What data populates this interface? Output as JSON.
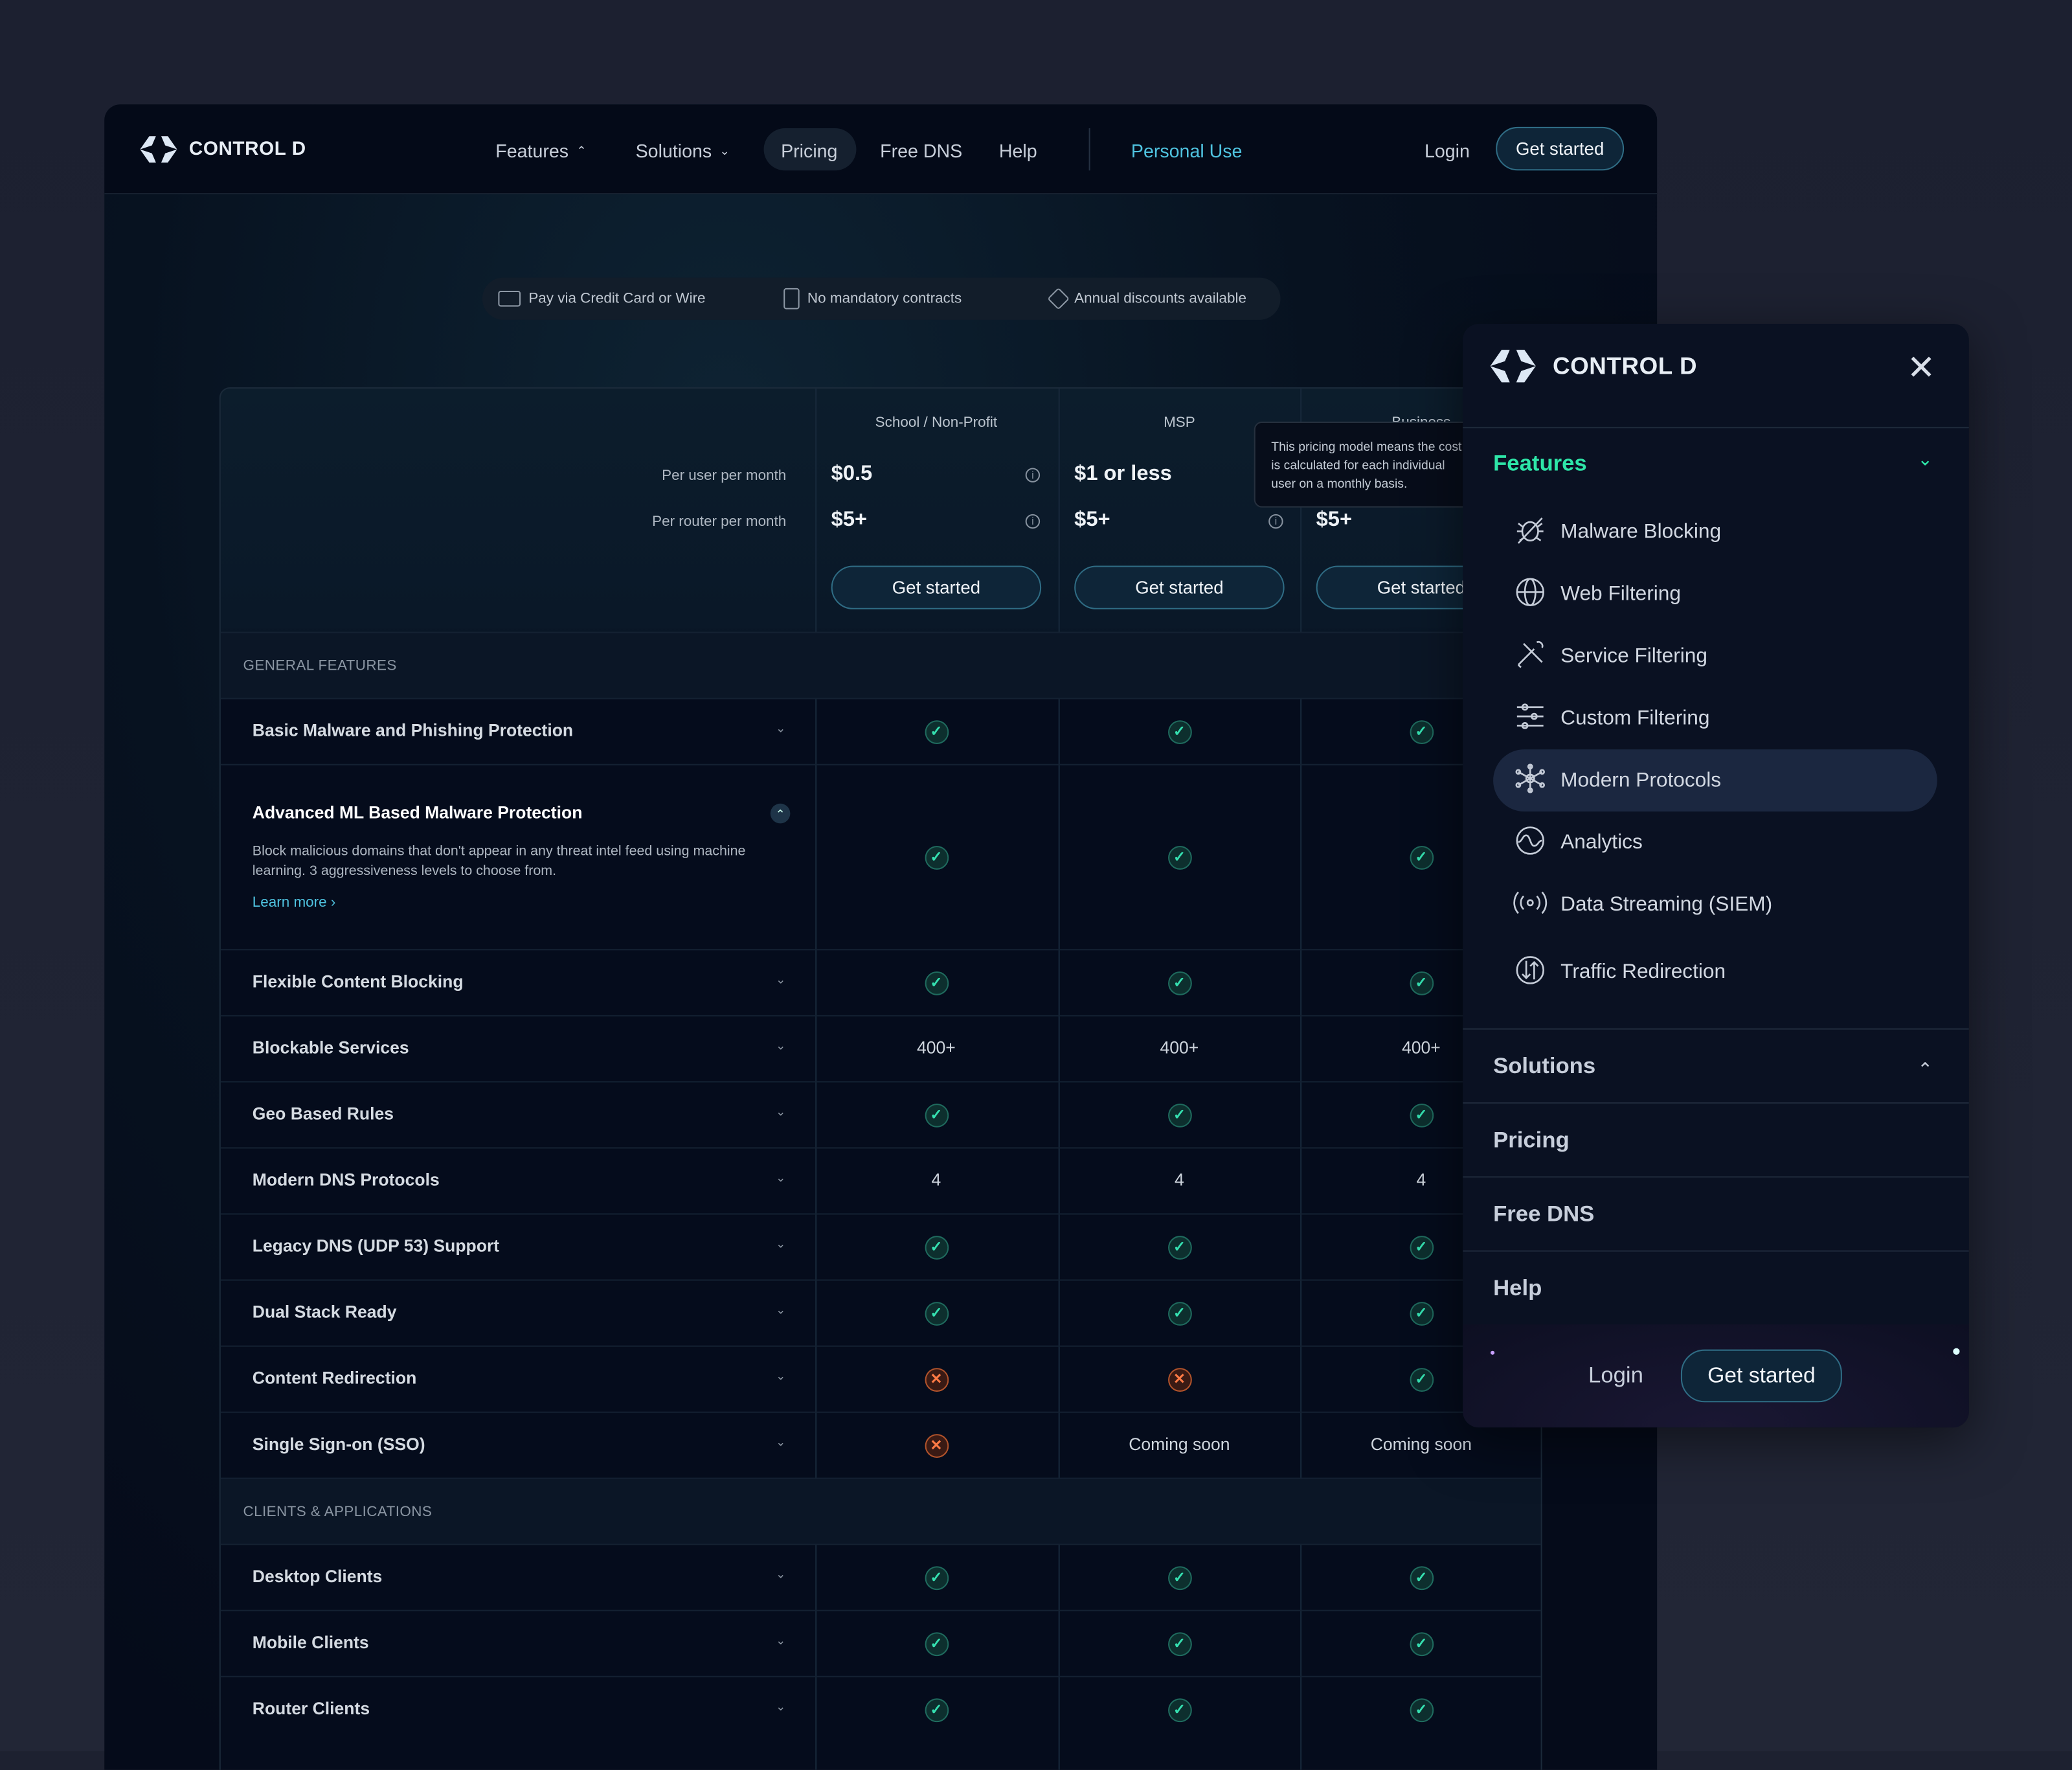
{
  "nav": {
    "brand": "CONTROL D",
    "items": [
      "Features",
      "Solutions",
      "Pricing",
      "Free DNS",
      "Help"
    ],
    "personal_use": "Personal Use",
    "login": "Login",
    "get_started": "Get started",
    "accent": "#4fc3e0"
  },
  "perks": [
    "Pay via Credit Card or Wire",
    "No mandatory contracts",
    "Annual discounts available"
  ],
  "plans": [
    {
      "name": "School / Non-Profit",
      "per_user": "$0.5",
      "per_router": "$5+",
      "cta": "Get started"
    },
    {
      "name": "MSP",
      "per_user": "$1 or less",
      "per_router": "$5+",
      "cta": "Get started"
    },
    {
      "name": "Business",
      "per_user": "",
      "per_router": "$5+",
      "cta": "Get started"
    }
  ],
  "price_labels": {
    "per_user": "Per user per month",
    "per_router": "Per router per month"
  },
  "tooltip": [
    "This pricing model means the cost",
    "is calculated for each individual",
    "user on a monthly basis."
  ],
  "rows": [
    {
      "type": "section",
      "label": "GENERAL FEATURES"
    },
    {
      "type": "row",
      "label": "Basic Malware and Phishing Protection",
      "values": [
        "check",
        "check",
        "check"
      ]
    },
    {
      "type": "expanded",
      "label": "Advanced ML Based Malware Protection",
      "description": "Block malicious domains that don't appear in any threat intel feed using machine learning. 3 aggressiveness levels to choose from.",
      "link": "Learn more",
      "values": [
        "check",
        "check",
        "check"
      ]
    },
    {
      "type": "row",
      "label": "Flexible Content Blocking",
      "values": [
        "check",
        "check",
        "check"
      ]
    },
    {
      "type": "row",
      "label": "Blockable Services",
      "values": [
        "400+",
        "400+",
        "400+"
      ]
    },
    {
      "type": "row",
      "label": "Geo Based Rules",
      "values": [
        "check",
        "check",
        "check"
      ]
    },
    {
      "type": "row",
      "label": "Modern DNS Protocols",
      "values": [
        "4",
        "4",
        "4"
      ]
    },
    {
      "type": "row",
      "label": "Legacy DNS (UDP 53) Support",
      "values": [
        "check",
        "check",
        "check"
      ]
    },
    {
      "type": "row",
      "label": "Dual Stack Ready",
      "values": [
        "check",
        "check",
        "check"
      ]
    },
    {
      "type": "row",
      "label": "Content Redirection",
      "values": [
        "cross",
        "cross",
        "check"
      ]
    },
    {
      "type": "row",
      "label": "Single Sign-on (SSO)",
      "values": [
        "cross",
        "Coming soon",
        "Coming soon"
      ]
    },
    {
      "type": "section",
      "label": "CLIENTS & APPLICATIONS"
    },
    {
      "type": "row",
      "label": "Desktop Clients",
      "values": [
        "check",
        "check",
        "check"
      ]
    },
    {
      "type": "row",
      "label": "Mobile Clients",
      "values": [
        "check",
        "check",
        "check"
      ]
    },
    {
      "type": "row",
      "label": "Router Clients",
      "values": [
        "check",
        "check",
        "check"
      ]
    }
  ],
  "menu": {
    "brand": "CONTROL D",
    "features_label": "Features",
    "features": [
      {
        "label": "Malware Blocking",
        "icon": "bug-icon"
      },
      {
        "label": "Web Filtering",
        "icon": "globe-icon"
      },
      {
        "label": "Service Filtering",
        "icon": "tools-icon"
      },
      {
        "label": "Custom Filtering",
        "icon": "sliders-icon"
      },
      {
        "label": "Modern Protocols",
        "icon": "network-icon",
        "active": true
      },
      {
        "label": "Analytics",
        "icon": "pulse-icon"
      },
      {
        "label": "Data Streaming (SIEM)",
        "icon": "broadcast-icon"
      },
      {
        "label": "Traffic Redirection",
        "icon": "arrows-icon"
      }
    ],
    "solutions": "Solutions",
    "pricing": "Pricing",
    "free_dns": "Free DNS",
    "help": "Help",
    "login": "Login",
    "get_started": "Get started",
    "accent": "#2ee6a8"
  }
}
